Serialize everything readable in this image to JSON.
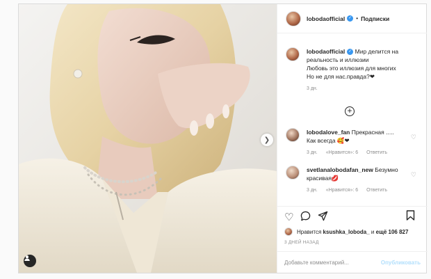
{
  "header": {
    "username": "lobodaofficial",
    "separator": "•",
    "follow_label": "Подписки"
  },
  "caption": {
    "username": "lobodaofficial",
    "line1": "Мир делится на",
    "line2": "реальность и иллюзии",
    "line3": "Любовь это иллюзия для многих",
    "line4": "Но не для нас.правда?❤",
    "time": "3 дн."
  },
  "comments": [
    {
      "username": "lobodalove_fan",
      "text": "Прекрасная .....",
      "text2": "Как всегда 🥰❤",
      "time": "3 дн.",
      "likes": "«Нравится»: 6",
      "reply": "Ответить"
    },
    {
      "username": "svetlanalobodafan_new",
      "text": "Безумно",
      "text2": "красивая💋",
      "time": "3 дн.",
      "likes": "«Нравится»: 6",
      "reply": "Ответить"
    }
  ],
  "likes": {
    "prefix": "Нравится",
    "user": "ksushka_loboda_",
    "mid": "и",
    "count": "ещё 106 827"
  },
  "time_ago": "3 ДНЕЙ НАЗАД",
  "add_comment": {
    "placeholder": "Добавьте комментарий...",
    "publish": "Опубликовать"
  },
  "icons": {
    "like": "heart-icon",
    "comment": "comment-icon",
    "share": "share-icon",
    "save": "bookmark-icon",
    "next": "chevron-right-icon",
    "tag": "user-tag-icon",
    "more": "plus-circle-icon"
  }
}
